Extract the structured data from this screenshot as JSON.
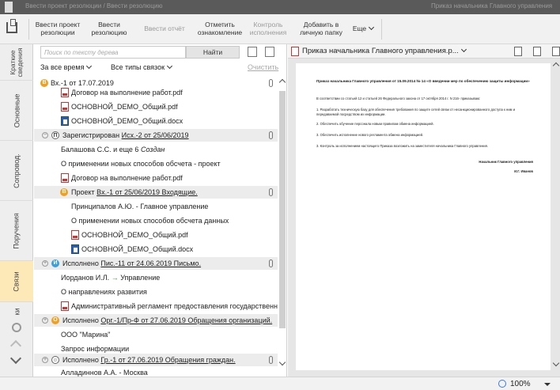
{
  "topbar": {
    "left_title": "Ввести проект резолюции / Ввести резолюцию",
    "right_title": "Приказ начальника Главного управления"
  },
  "toolbar": {
    "buttons": [
      {
        "label": "Ввести проект\nрезолюции",
        "enabled": true
      },
      {
        "label": "Ввести\nрезолюцию",
        "enabled": true
      },
      {
        "label": "Ввести отчёт",
        "enabled": false
      },
      {
        "label": "Отметить\nознакомление",
        "enabled": true
      },
      {
        "label": "Контроль\nисполнения",
        "enabled": false
      },
      {
        "label": "Добавить в\nличную папку",
        "enabled": true
      },
      {
        "label": "Еще",
        "enabled": true
      }
    ]
  },
  "vtabs": [
    {
      "label": "Краткие сведения"
    },
    {
      "label": "Основные"
    },
    {
      "label": "Сопровод."
    },
    {
      "label": "Поручения"
    },
    {
      "label": "Связи",
      "active": true
    },
    {
      "label": "ки"
    }
  ],
  "search": {
    "placeholder": "Поиск по тексту дерева",
    "button": "Найти"
  },
  "filters": {
    "period": "За все время",
    "types": "Все типы связок",
    "clear": "Очистить"
  },
  "tree": {
    "r0": {
      "prefix": "Вх.-1 от 17.07.2019"
    },
    "r1": {
      "text": "Договор на выполнение работ.pdf"
    },
    "r2": {
      "text": "ОСНОВНОЙ_DEMO_Общий.pdf"
    },
    "r3": {
      "text": "ОСНОВНОЙ_DEMO_Общий.docx"
    },
    "r4": {
      "status": "Зарегистрирован",
      "link": "Исх.-2 от 25/06/2019"
    },
    "r5": {
      "text": "Балашова С.С.  и еще 6",
      "extra": "Создан"
    },
    "r6": {
      "text": "О применении новых способов обсчета - проект"
    },
    "r7": {
      "text": "Договор на выполнение работ.pdf"
    },
    "r8": {
      "status": "Проект",
      "link": "Вх.-1 от 25/06/2019 Входящие."
    },
    "r9": {
      "text": "Принципалов А.Ю. - Главное управление"
    },
    "r10": {
      "text": "О применении новых способов обсчета данных"
    },
    "r11": {
      "text": "ОСНОВНОЙ_DEMO_Общий.pdf"
    },
    "r12": {
      "text": "ОСНОВНОЙ_DEMO_Общий.docx"
    },
    "r13": {
      "status": "Исполнено",
      "link": "Пис.-11 от 24.06.2019 Письмо."
    },
    "r14": {
      "text": "Иорданов И.Л.",
      "arrow": "→",
      "to": "Управление"
    },
    "r15": {
      "text": "О направлениях развития"
    },
    "r16": {
      "text": "Административный регламент предоставления государственной у..."
    },
    "r17": {
      "status": "Исполнено",
      "link": "Орг.-1/Пр-Ф от 27.06.2019 Обращения организаций."
    },
    "r18": {
      "text": "ООО \"Марина\""
    },
    "r19": {
      "text": "Запрос информации"
    },
    "r20": {
      "status": "Исполнено",
      "link": "Гр.-1 от 27.06.2019 Обращения граждан."
    },
    "r21": {
      "text": "Алладиннов А.А. - Москва"
    }
  },
  "viewer": {
    "filename": "Приказ начальника Главного управления.р...",
    "doc": {
      "title": "Приказ начальника Главного управления от 15.09.2014 № 14 «О введении мер по обеспечению защиты информации»",
      "p1": "В соответствии со статьей 12 и статьей 26 Федерального закона от 17 октября 2014 г. N 216- приказываю:",
      "p2": "1. Разработать техническую базу для обеспечения требования по защите сетей связи от несанкционированного доступа к ним и передаваемой посредством их информации.",
      "p3": "2. Обеспечить обучение персонала новым правилам обмена информацией.",
      "p4": "3. Обеспечить исполнение нового регламента обмена информацией.",
      "p5": "3. Контроль за исполнением настоящего Приказа возложить на заместителя  начальника Главного управления.",
      "sign_title": "Начальник Главного управления",
      "sign_name": "И.Г. Иванов"
    }
  },
  "status": {
    "zoom": "100%"
  },
  "colors": {
    "accent": "#f0a020",
    "active_tab": "#fde9b8",
    "link_blue": "#3aa0d8"
  }
}
